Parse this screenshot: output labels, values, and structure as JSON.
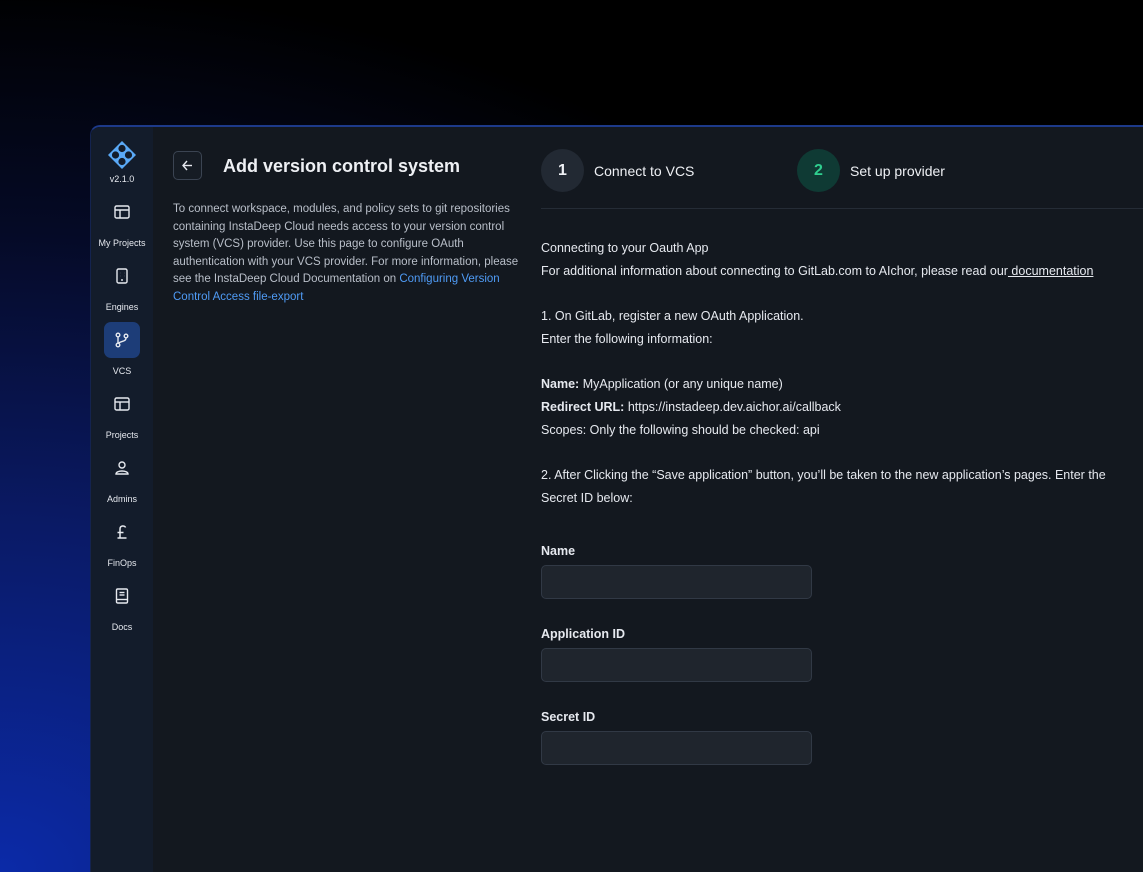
{
  "sidebar": {
    "version": "v2.1.0",
    "items": [
      {
        "label": "My Projects",
        "icon": "projects-icon"
      },
      {
        "label": "Engines",
        "icon": "engine-icon"
      },
      {
        "label": "VCS",
        "icon": "git-branch-icon",
        "active": true
      },
      {
        "label": "Projects",
        "icon": "projects-icon"
      },
      {
        "label": "Admins",
        "icon": "admin-icon"
      },
      {
        "label": "FinOps",
        "icon": "pound-icon"
      },
      {
        "label": "Docs",
        "icon": "book-icon"
      }
    ]
  },
  "header": {
    "title": "Add version control system",
    "intro": "To connect workspace, modules, and policy sets to git repositories containing InstaDeep Cloud needs access to your version control system (VCS) provider. Use this page to configure OAuth authentication with your VCS provider. For more information, please see the InstaDeep Cloud Documentation on",
    "intro_link": "Configuring Version Control Access  file-export"
  },
  "steps": [
    {
      "number": "1",
      "label": "Connect to VCS"
    },
    {
      "number": "2",
      "label": "Set  up provider"
    }
  ],
  "content": {
    "heading": "Connecting to your Oauth App",
    "info_prefix": "For additional information about connecting to GitLab.com to AIchor, please read our",
    "info_link": " documentation",
    "step1_line1": "1. On GitLab, register a new OAuth Application.",
    "step1_line2": "Enter the following information:",
    "name_key": "Name:",
    "name_value": " MyApplication (or any unique name)",
    "redirect_key": "Redirect URL:",
    "redirect_value": " https://instadeep.dev.aichor.ai/callback",
    "scopes": "Scopes: Only the following should be checked: api",
    "step2_line1": "2. After Clicking the “Save application” button, you’ll be taken to the new application’s pages. Enter the",
    "step2_line2": "Secret ID below:"
  },
  "form": {
    "name_label": "Name",
    "name_value": "",
    "app_id_label": "Application ID",
    "app_id_value": "",
    "secret_label": "Secret ID",
    "secret_value": ""
  },
  "colors": {
    "accent": "#4f9bf5",
    "active_nav": "#1d3d78",
    "step_current": "#2fcf8f"
  }
}
